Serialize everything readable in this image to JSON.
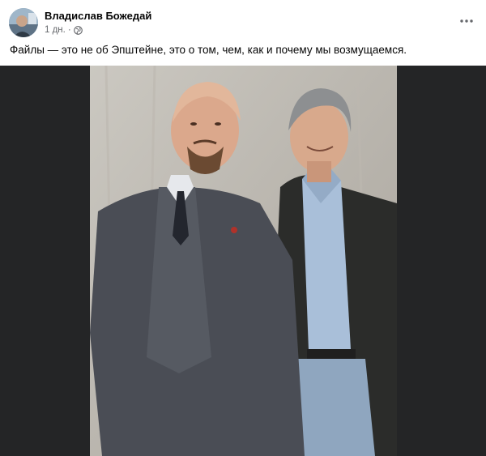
{
  "post": {
    "author_name": "Владислав Божедай",
    "timestamp": "1 дн.",
    "separator": "·",
    "privacy_icon": "globe-icon",
    "menu_icon": "more-horizontal-icon",
    "text": "Файлы — это не об Эпштейне, это о том, чем, как и почему мы возмущаемся."
  },
  "colors": {
    "text_primary": "#050505",
    "text_secondary": "#65676b",
    "image_letterbox": "#242526"
  }
}
